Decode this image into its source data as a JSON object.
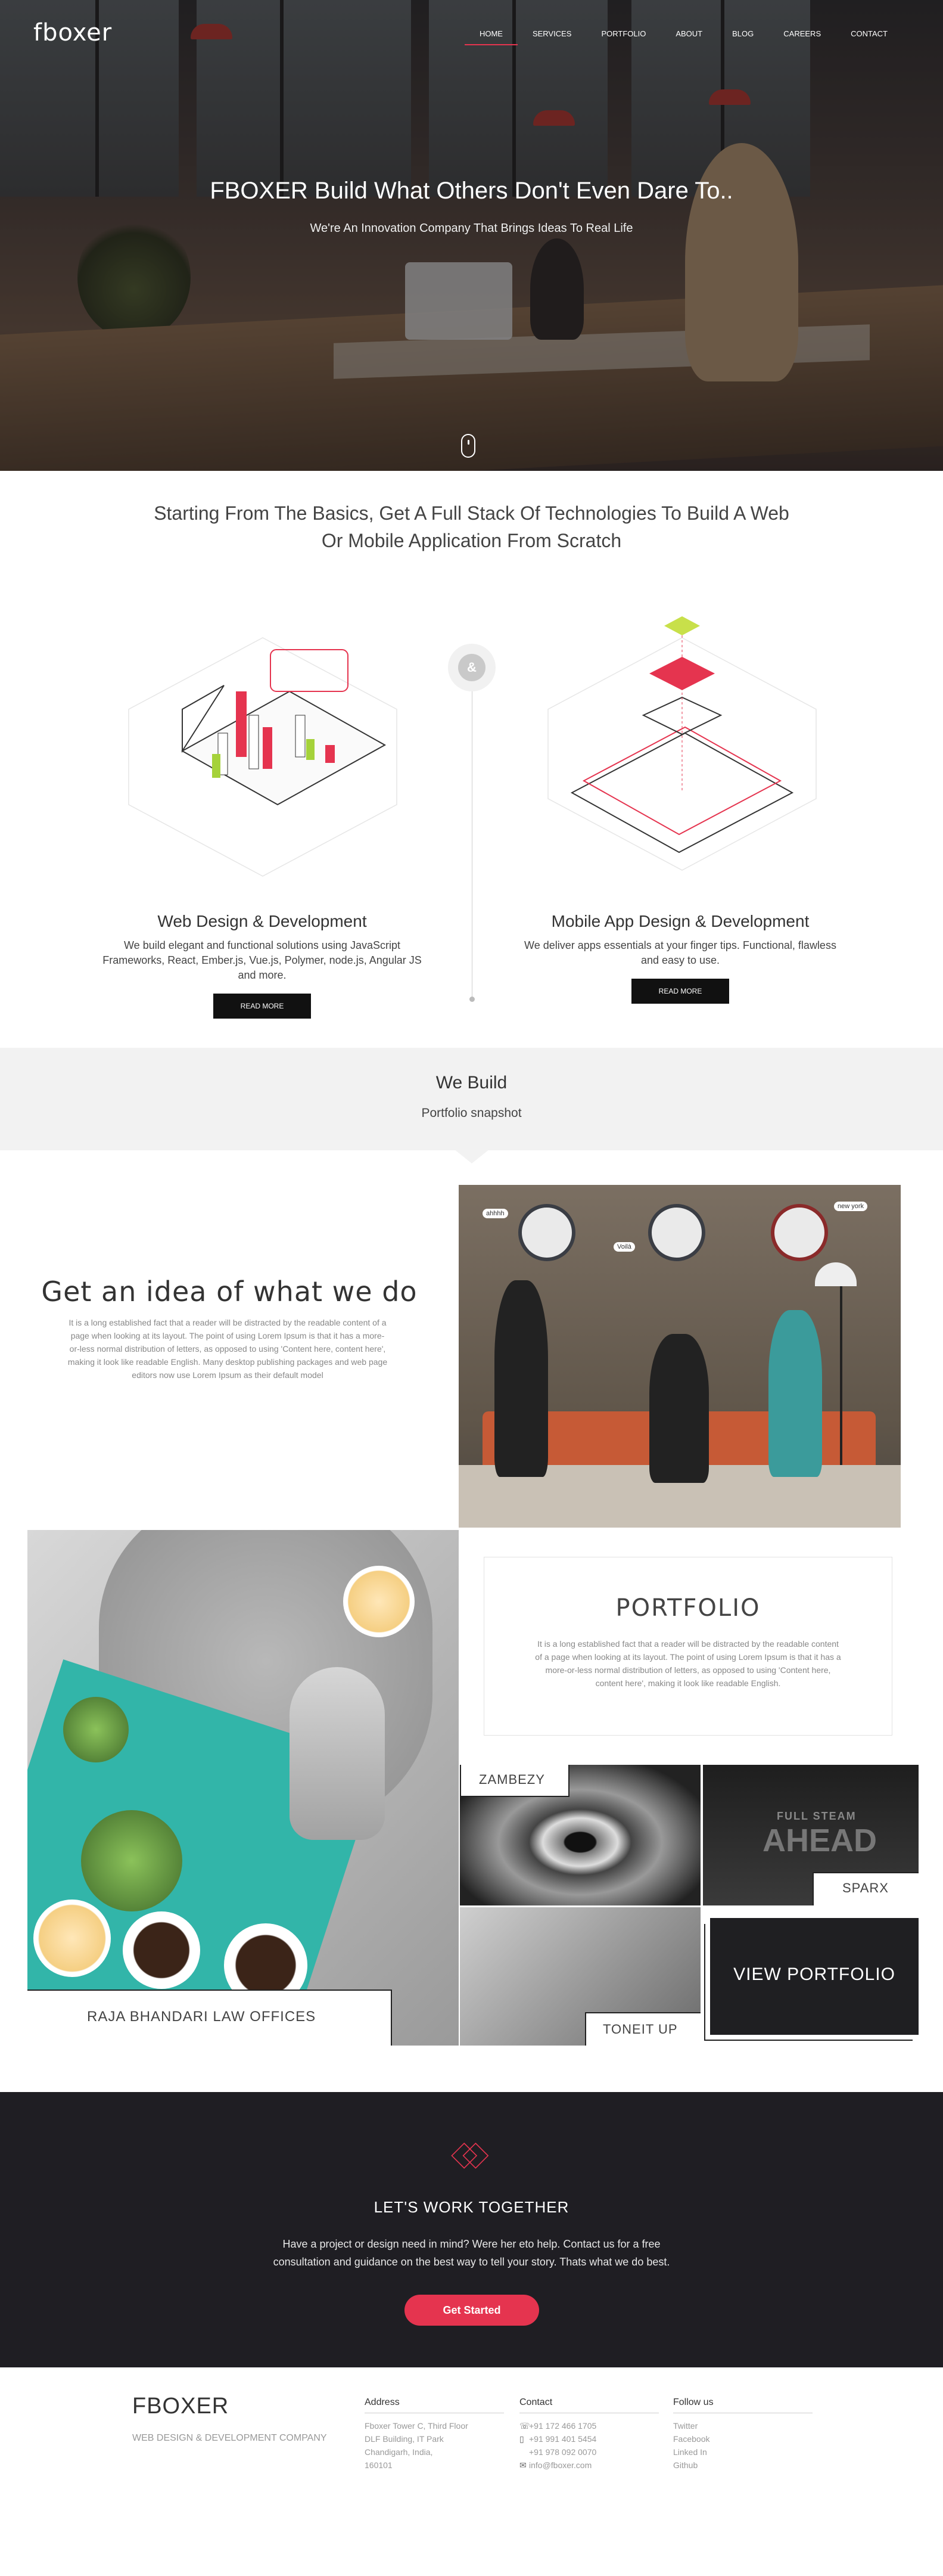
{
  "header": {
    "logo": "fboxer",
    "nav": [
      {
        "label": "HOME",
        "active": true
      },
      {
        "label": "SERVICES"
      },
      {
        "label": "PORTFOLIO"
      },
      {
        "label": "ABOUT"
      },
      {
        "label": "BLOG"
      },
      {
        "label": "CAREERS"
      },
      {
        "label": "CONTACT"
      }
    ]
  },
  "hero": {
    "title": "FBOXER Build What Others Don't Even Dare To..",
    "subtitle": "We're An Innovation Company That Brings Ideas To Real Life"
  },
  "intro": {
    "title_line1": "Starting From The Basics, Get A Full Stack Of Technologies To Build A Web",
    "title_line2": "Or Mobile Application From Scratch",
    "ampersand": "&"
  },
  "services": [
    {
      "title": "Web Design & Development",
      "line1": "We build elegant and functional solutions using JavaScript",
      "line2": "Frameworks, React, Ember.js, Vue.js, Polymer, node.js, Angular JS",
      "line3": "and more.",
      "button": "READ MORE"
    },
    {
      "title": "Mobile App Design & Development",
      "line1": "We deliver apps essentials at your finger tips. Functional, flawless",
      "line2": "and easy to use.",
      "button": "READ MORE"
    }
  ],
  "we_build": {
    "title": "We Build",
    "subtitle": "Portfolio snapshot"
  },
  "idea": {
    "title": "Get an idea of what we do",
    "body": "It is a long established fact that a reader will be distracted by the readable content of a page when looking at its layout. The point of using Lorem Ipsum is that it has a more-or-less normal distribution of letters, as opposed to using 'Content here, content here', making it look like readable English. Many desktop publishing packages and web page editors now use Lorem Ipsum as their default model"
  },
  "photo_team": {
    "bubble1": "ahhhh",
    "bubble2": "Voilà",
    "bubble3": "new york"
  },
  "portfolio": {
    "title": "PORTFOLIO",
    "body": "It is a long established fact that a reader will be distracted by the readable content of a page when looking at its layout. The point of using Lorem Ipsum is that it has a more-or-less normal distribution of letters, as opposed to using 'Content here, content here', making it look like readable English.",
    "raja_caption": "RAJA BHANDARI LAW OFFICES",
    "zambezy": "ZAMBEZY",
    "sparx": "SPARX",
    "toneit": "TONEIT UP",
    "view_portfolio": "VIEW PORTFOLIO",
    "ahead_small": "FULL STEAM",
    "ahead_big": "AHEAD"
  },
  "cta": {
    "title": "LET'S WORK TOGETHER",
    "line1": "Have a project or design need in mind? Were her eto help. Contact us for a free",
    "line2": "consultation and guidance on the best way to tell your story. Thats what we do best.",
    "button": "Get Started",
    "accent": "#e5344f"
  },
  "footer": {
    "brand": "FBOXER",
    "tagline": "WEB DESIGN & DEVELOPMENT COMPANY",
    "address": {
      "title": "Address",
      "lines": [
        "Fboxer Tower C, Third Floor",
        "DLF Building, IT Park",
        "Chandigarh, India,",
        "160101"
      ]
    },
    "contact": {
      "title": "Contact",
      "phone1": "+91 172 466 1705",
      "phone2": "+91 991 401 5454",
      "phone3": "+91 978 092 0070",
      "email": "info@fboxer.com"
    },
    "follow": {
      "title": "Follow us",
      "links": [
        "Twitter",
        "Facebook",
        "Linked In",
        "Github"
      ]
    }
  }
}
